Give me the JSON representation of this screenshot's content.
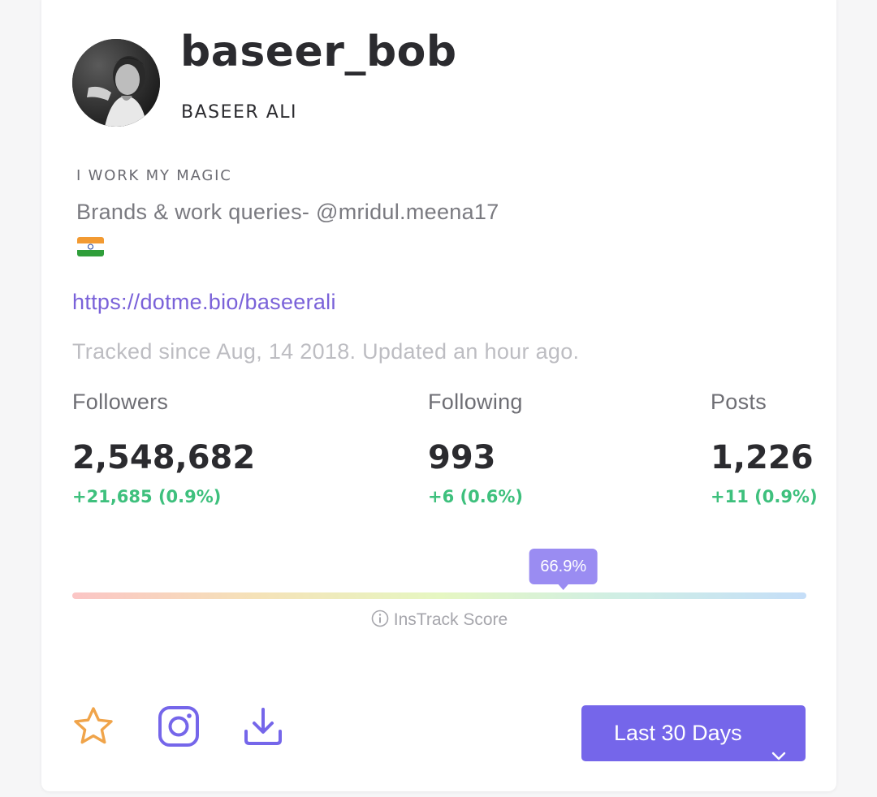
{
  "profile": {
    "username": "baseer_bob",
    "full_name": "BASEER ALI",
    "bio_title": "I WORK MY MAGIC",
    "bio_line": "Brands & work queries- @mridul.meena17",
    "bio_flag": "india-flag-icon",
    "link": "https://dotme.bio/baseerali",
    "tracked_text": "Tracked since Aug, 14 2018. Updated an hour ago."
  },
  "stats": {
    "followers": {
      "label": "Followers",
      "value": "2,548,682",
      "change": "+21,685 (0.9%)"
    },
    "following": {
      "label": "Following",
      "value": "993",
      "change": "+6 (0.6%)"
    },
    "posts": {
      "label": "Posts",
      "value": "1,226",
      "change": "+11 (0.9%)"
    }
  },
  "score": {
    "value_percent": 66.9,
    "value_label": "66.9%",
    "caption": "InsTrack Score",
    "caption_icon": "info-icon"
  },
  "actions": {
    "favorite_icon": "star-icon",
    "instagram_icon": "instagram-icon",
    "download_icon": "download-icon",
    "period_label": "Last 30 Days",
    "period_icon": "chevron-down-icon"
  },
  "colors": {
    "accent": "#7566ea",
    "link": "#7a62d9",
    "positive": "#3ec07d",
    "star": "#f0a44a",
    "score_gradient": [
      "#fbc5c5",
      "#f5e2b8",
      "#e6f7c2",
      "#cfeee5",
      "#c5def8"
    ]
  }
}
